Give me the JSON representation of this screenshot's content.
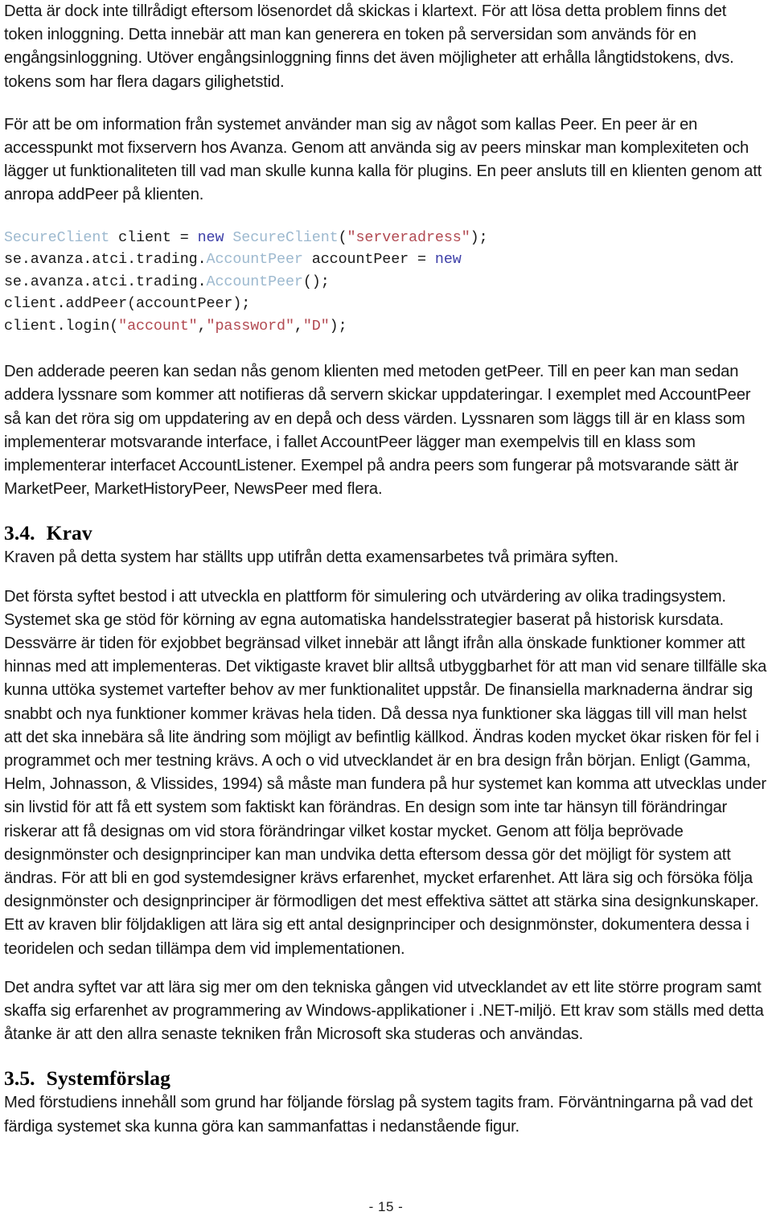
{
  "document": {
    "page_number_label": "- 15 -"
  },
  "paragraphs": {
    "p1": "Detta är dock inte tillrådigt eftersom lösenordet då skickas i klartext. För att lösa detta problem finns det token inloggning. Detta innebär att man kan generera en token på serversidan som används för en engångsinloggning. Utöver engångsinloggning finns det även möjligheter att erhålla långtidstokens, dvs. tokens som har flera dagars gilighetstid.",
    "p2": "För att be om information från systemet använder man sig av något som kallas Peer. En peer är en accesspunkt mot fixservern hos Avanza. Genom att använda sig av peers minskar man komplexiteten och lägger ut funktionaliteten till vad man skulle kunna kalla för plugins. En peer ansluts till en klienten genom att anropa addPeer på klienten.",
    "p3": "Den adderade peeren kan sedan nås genom klienten med metoden getPeer. Till en peer kan man sedan addera lyssnare som kommer att notifieras då servern skickar uppdateringar. I exemplet med AccountPeer så kan det röra sig om uppdatering av en depå och dess värden. Lyssnaren som läggs till är en klass som implementerar motsvarande interface, i fallet AccountPeer lägger man exempelvis till en klass som implementerar interfacet AccountListener. Exempel på andra peers som fungerar på motsvarande sätt är MarketPeer, MarketHistoryPeer, NewsPeer med flera.",
    "p4": "Kraven på detta system har ställts upp utifrån detta examensarbetes två primära syften.",
    "p5": "Det första syftet bestod i att utveckla en plattform för simulering och utvärdering av olika tradingsystem. Systemet ska ge stöd för körning av egna automatiska handelsstrategier baserat på historisk kursdata. Dessvärre är tiden för exjobbet begränsad vilket innebär att långt ifrån alla önskade funktioner kommer att hinnas med att implementeras. Det viktigaste kravet blir alltså utbyggbarhet för att man vid senare tillfälle ska kunna uttöka systemet vartefter behov av mer funktionalitet uppstår. De finansiella marknaderna ändrar sig snabbt och nya funktioner kommer krävas hela tiden. Då dessa nya funktioner ska läggas till vill man helst att det ska innebära så lite ändring som möjligt av befintlig källkod. Ändras koden mycket ökar risken för fel i programmet och mer testning krävs. A och o vid utvecklandet är en bra design från början. Enligt (Gamma, Helm, Johnasson, & Vlissides, 1994) så måste man fundera på hur systemet kan komma att utvecklas under sin livstid för att få ett system som faktiskt kan förändras. En design som inte tar hänsyn till förändringar riskerar att få designas om vid stora förändringar vilket kostar mycket. Genom att följa beprövade designmönster och designprinciper kan man undvika detta eftersom dessa gör det möjligt för system att ändras. För att bli en god systemdesigner krävs erfarenhet, mycket erfarenhet.  Att lära sig och försöka följa designmönster och designprinciper är förmodligen det mest effektiva sättet att stärka sina designkunskaper.  Ett av kraven blir följdakligen att lära sig ett antal designprinciper och designmönster, dokumentera dessa i teoridelen och sedan tillämpa dem vid implementationen.",
    "p6": "Det andra syftet var att lära sig mer om den tekniska gången vid utvecklandet av ett lite större program samt skaffa sig erfarenhet av programmering av Windows-applikationer i .NET-miljö. Ett krav som ställs med detta åtanke är att den allra senaste tekniken från Microsoft ska studeras och användas.",
    "p7": "Med förstudiens innehåll som grund har följande förslag på system tagits fram. Förväntningarna på vad det färdiga systemet ska kunna göra kan sammanfattas i nedanstående figur."
  },
  "headings": {
    "h34_number": "3.4.",
    "h34_title": "Krav",
    "h35_number": "3.5.",
    "h35_title": "Systemförslag"
  },
  "code_sample": {
    "line1": {
      "t1": "SecureClient",
      "t2": " client = ",
      "t3": "new",
      "t4": " SecureClient",
      "t5": "(",
      "t6": "\"serveradress\"",
      "t7": ");"
    },
    "line2": {
      "t1": "se.avanza.atci.trading.",
      "t2": "AccountPeer",
      "t3": " accountPeer = ",
      "t4": "new"
    },
    "line3": {
      "t1": "se.avanza.atci.trading.",
      "t2": "AccountPeer",
      "t3": "();"
    },
    "line4": {
      "t1": "client.addPeer(accountPeer);"
    },
    "line5": {
      "t1": "client.login(",
      "t2": "\"account\"",
      "t3": ",",
      "t4": "\"password\"",
      "t5": ",",
      "t6": "\"D\"",
      "t7": ");"
    }
  },
  "colors": {
    "type_token": "#9db9cf",
    "keyword_token": "#3d3fa8",
    "string_token": "#b24a52",
    "body_text": "#171717",
    "background": "#ffffff"
  }
}
